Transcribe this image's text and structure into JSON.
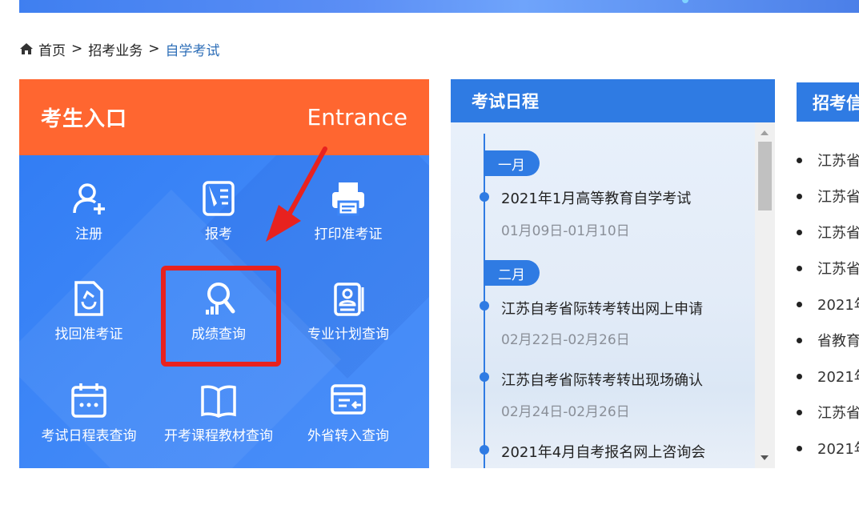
{
  "breadcrumb": {
    "home": "首页",
    "sep": ">",
    "level2": "招考业务",
    "current": "自学考试"
  },
  "entrance": {
    "title": "考生入口",
    "title_en": "Entrance",
    "items": [
      {
        "label": "注册",
        "icon": "user-add-icon"
      },
      {
        "label": "报考",
        "icon": "document-edit-icon"
      },
      {
        "label": "打印准考证",
        "icon": "printer-icon"
      },
      {
        "label": "找回准考证",
        "icon": "refresh-file-icon"
      },
      {
        "label": "成绩查询",
        "icon": "search-chart-icon"
      },
      {
        "label": "专业计划查询",
        "icon": "id-card-icon"
      },
      {
        "label": "考试日程表查询",
        "icon": "calendar-icon"
      },
      {
        "label": "开考课程教材查询",
        "icon": "book-icon"
      },
      {
        "label": "外省转入查询",
        "icon": "transfer-card-icon"
      }
    ],
    "highlight_color": "#e8221f"
  },
  "schedule": {
    "title": "考试日程",
    "months": [
      "一月",
      "二月"
    ],
    "events": [
      {
        "title": "2021年1月高等教育自学考试",
        "date": "01月09日-01月10日"
      },
      {
        "title": "江苏自考省际转考转出网上申请",
        "date": "02月22日-02月26日"
      },
      {
        "title": "江苏自考省际转考转出现场确认",
        "date": "02月24日-02月26日"
      },
      {
        "title": "2021年4月自考报名网上咨询会",
        "date": ""
      }
    ]
  },
  "info": {
    "title": "招考信",
    "items": [
      "江苏省",
      "江苏省",
      "江苏省",
      "江苏省",
      "2021年",
      "省教育",
      "2021年",
      "江苏省",
      "2021年"
    ]
  },
  "colors": {
    "orange": "#ff6630",
    "blue": "#2f7be3",
    "link": "#2f6fb8"
  }
}
